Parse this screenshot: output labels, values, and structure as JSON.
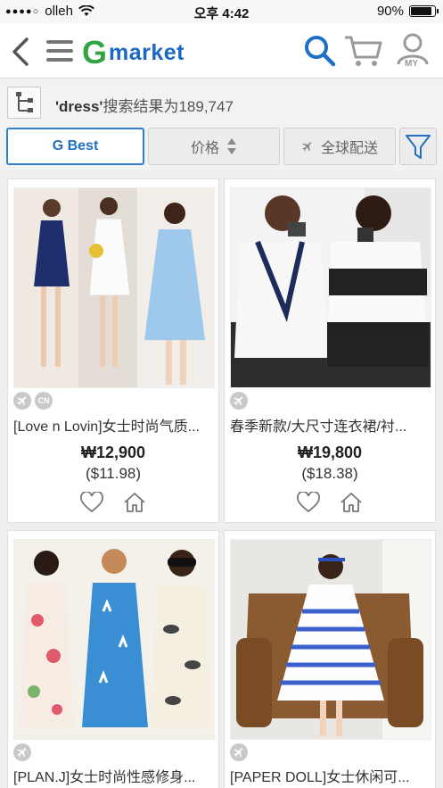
{
  "status_bar": {
    "carrier": "olleh",
    "time": "오후 4:42",
    "battery": "90%",
    "battery_level": 0.9
  },
  "header": {
    "logo_g": "G",
    "logo_rest": "market",
    "my_label": "MY",
    "brand_green": "#33a443",
    "brand_blue": "#1a67c4"
  },
  "search_result": {
    "query": "'dress'",
    "summary": "搜索结果为189,747"
  },
  "filters": {
    "best": "G Best",
    "price": "价格",
    "global": "全球配送"
  },
  "products": [
    {
      "title": "[Love n Lovin]女士时尚气质...",
      "price_krw": "₩12,900",
      "price_usd": "($11.98)",
      "badges": [
        "plane-icon",
        "CN"
      ]
    },
    {
      "title": "春季新款/大尺寸连衣裙/衬...",
      "price_krw": "₩19,800",
      "price_usd": "($18.38)",
      "badges": [
        "plane-icon"
      ]
    },
    {
      "title": "[PLAN.J]女士时尚性感修身...",
      "badges": [
        "plane-icon"
      ]
    },
    {
      "title": "[PAPER DOLL]女士休闲可...",
      "badges": [
        "plane-icon"
      ]
    }
  ]
}
